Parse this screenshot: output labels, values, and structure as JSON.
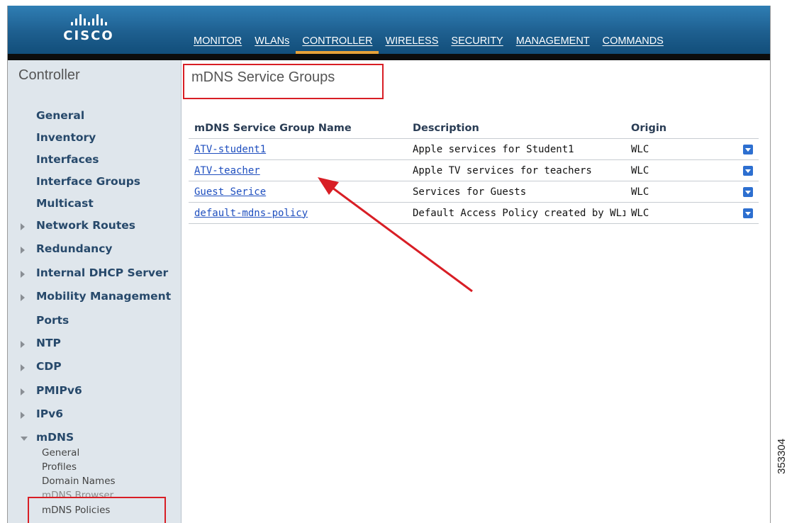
{
  "brand": {
    "name": "CISCO"
  },
  "nav": [
    {
      "label": "MONITOR",
      "active": false
    },
    {
      "label": "WLANs",
      "active": false
    },
    {
      "label": "CONTROLLER",
      "active": true
    },
    {
      "label": "WIRELESS",
      "active": false
    },
    {
      "label": "SECURITY",
      "active": false
    },
    {
      "label": "MANAGEMENT",
      "active": false
    },
    {
      "label": "COMMANDS",
      "active": false
    }
  ],
  "sidebar": {
    "title": "Controller",
    "items": [
      {
        "label": "General",
        "arrow": "none"
      },
      {
        "label": "Inventory",
        "arrow": "none"
      },
      {
        "label": "Interfaces",
        "arrow": "none"
      },
      {
        "label": "Interface Groups",
        "arrow": "none"
      },
      {
        "label": "Multicast",
        "arrow": "none"
      },
      {
        "label": "Network Routes",
        "arrow": "right"
      },
      {
        "label": "Redundancy",
        "arrow": "right"
      },
      {
        "label": "Internal DHCP Server",
        "arrow": "right"
      },
      {
        "label": "Mobility Management",
        "arrow": "right"
      },
      {
        "label": "Ports",
        "arrow": "none"
      },
      {
        "label": "NTP",
        "arrow": "right"
      },
      {
        "label": "CDP",
        "arrow": "right"
      },
      {
        "label": "PMIPv6",
        "arrow": "right"
      },
      {
        "label": "IPv6",
        "arrow": "right"
      },
      {
        "label": "mDNS",
        "arrow": "down"
      }
    ],
    "mdns_sub": [
      {
        "label": "General"
      },
      {
        "label": "Profiles"
      },
      {
        "label": "Domain Names"
      },
      {
        "label": "mDNS Browser"
      },
      {
        "label": "mDNS Policies"
      }
    ]
  },
  "main": {
    "title": "mDNS Service Groups",
    "columns": [
      "mDNS Service Group Name",
      "Description",
      "Origin"
    ],
    "rows": [
      {
        "name": "ATV-student1",
        "description": "Apple services for Student1",
        "origin": "WLC"
      },
      {
        "name": "ATV-teacher",
        "description": "Apple TV services for teachers",
        "origin": "WLC"
      },
      {
        "name": "Guest Serice",
        "description": "Services for Guests",
        "origin": "WLC"
      },
      {
        "name": "default-mdns-policy",
        "description": "Default Access Policy created by WLı",
        "origin": "WLC"
      }
    ]
  },
  "figure_id": "353304",
  "colors": {
    "highlight": "#d81e25",
    "header_blue": "#1e5f8f",
    "active_tab": "#e8a23a",
    "link": "#1f4fbf"
  }
}
